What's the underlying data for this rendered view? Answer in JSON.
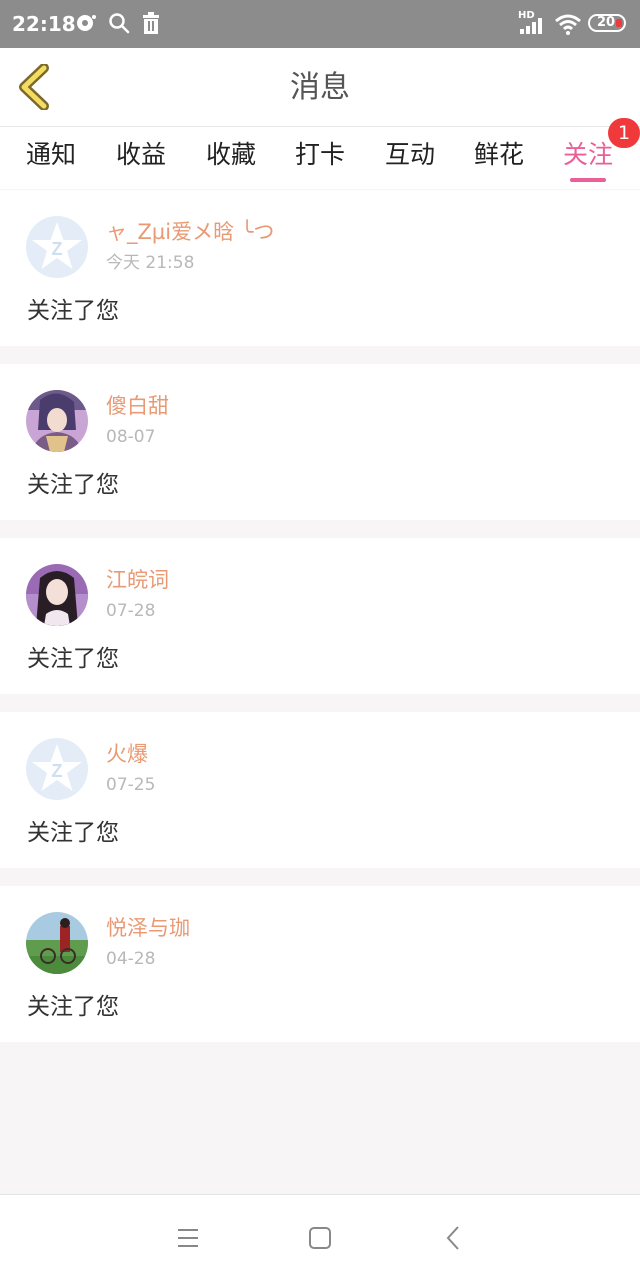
{
  "status_bar": {
    "time": "22:18",
    "network": "HD",
    "battery": "20"
  },
  "header": {
    "title": "消息",
    "back_icon": "chevron-left-icon"
  },
  "tabs": [
    {
      "label": "通知"
    },
    {
      "label": "收益"
    },
    {
      "label": "收藏"
    },
    {
      "label": "打卡"
    },
    {
      "label": "互动"
    },
    {
      "label": "鲜花"
    },
    {
      "label": "关注"
    }
  ],
  "active_tab_index": 6,
  "badge": {
    "count": "1"
  },
  "messages": [
    {
      "name": "ャ_Zµi爱メ晗 ╰つ",
      "time": "今天 21:58",
      "text": "关注了您",
      "avatar": "default-avatar"
    },
    {
      "name": "傻白甜",
      "time": "08-07",
      "text": "关注了您",
      "avatar": "anime-avatar"
    },
    {
      "name": "江皖词",
      "time": "07-28",
      "text": "关注了您",
      "avatar": "portrait-avatar"
    },
    {
      "name": "火爆",
      "time": "07-25",
      "text": "关注了您",
      "avatar": "default-avatar"
    },
    {
      "name": "悦泽与珈",
      "time": "04-28",
      "text": "关注了您",
      "avatar": "scenery-avatar"
    }
  ],
  "colors": {
    "accent": "#ea5f98",
    "username": "#e99a74",
    "badge": "#f0393b",
    "background": "#f7f5f6"
  }
}
